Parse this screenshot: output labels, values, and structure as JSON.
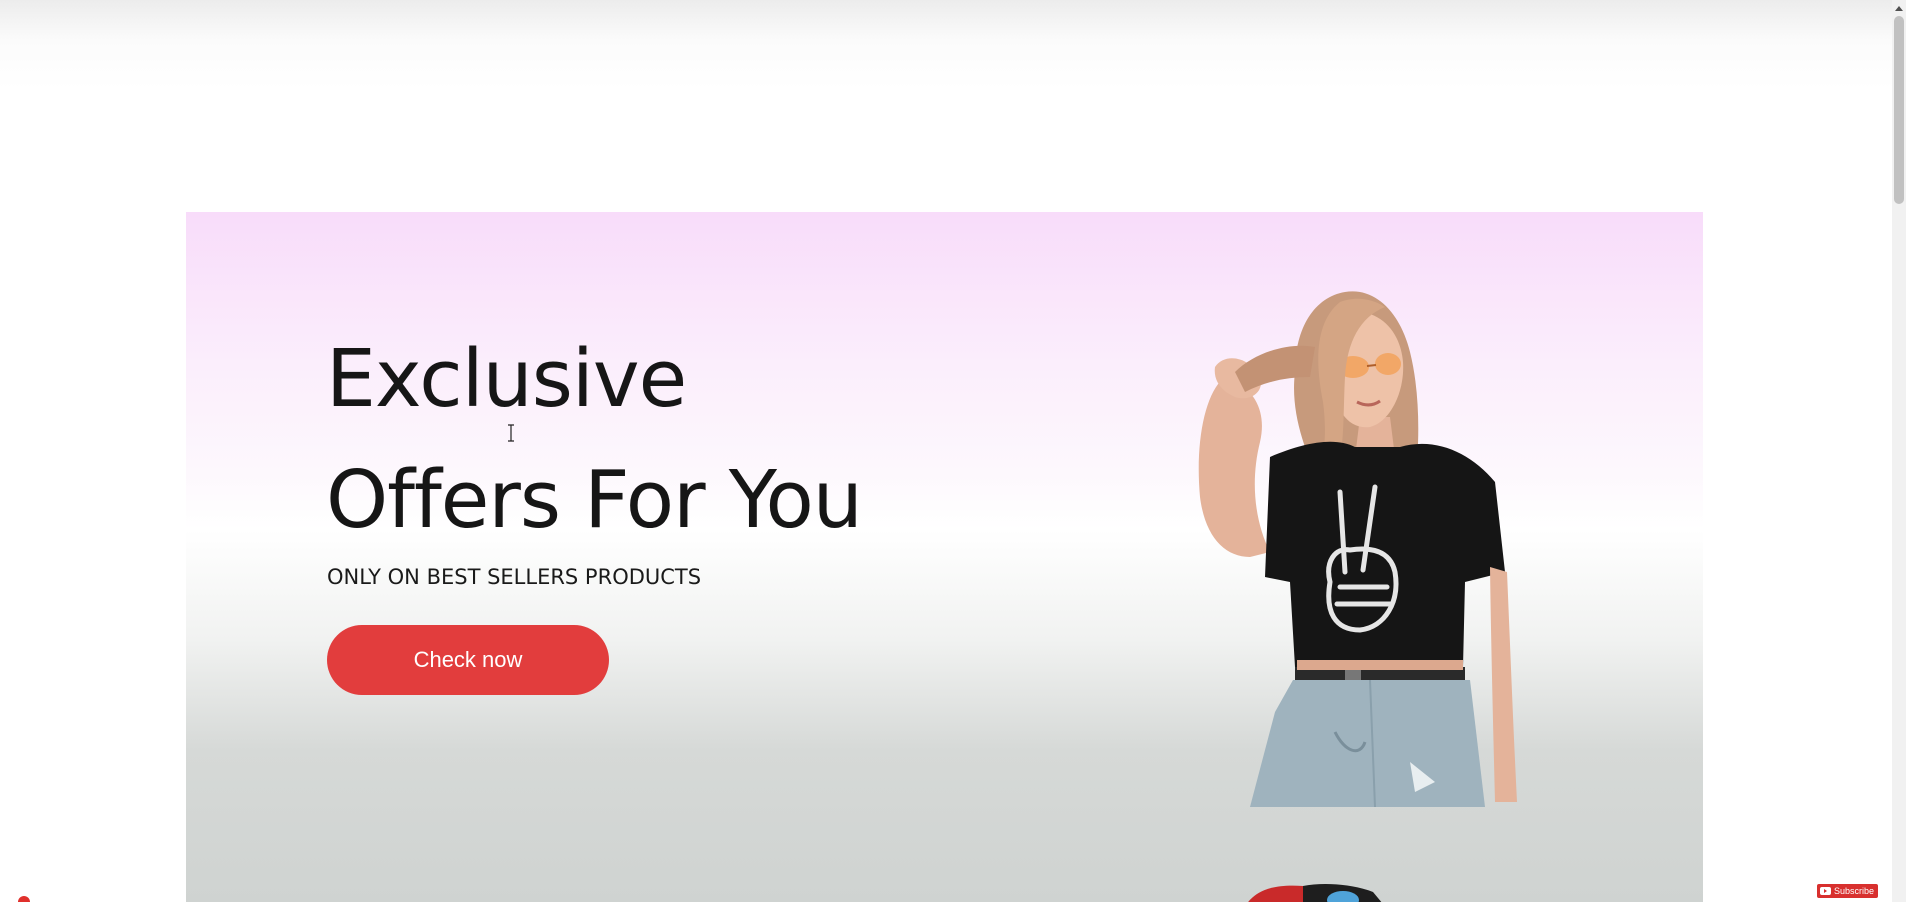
{
  "hero": {
    "title_line_1": "Exclusive",
    "title_line_2": "Offers For You",
    "subtitle": "ONLY ON BEST SELLERS PRODUCTS",
    "cta_label": "Check now",
    "model_image": "woman-in-black-tshirt-with-skeleton-peace-hand"
  },
  "overlay": {
    "subscribe_label": "Subscribe",
    "subscribe_icon": "youtube-play-icon"
  },
  "colors": {
    "cta_background": "#e23d3d",
    "cta_text": "#ffffff",
    "title_text": "#161616",
    "hero_gradient_top": "#f8dcfa",
    "hero_gradient_bottom": "#cfd3d1"
  }
}
